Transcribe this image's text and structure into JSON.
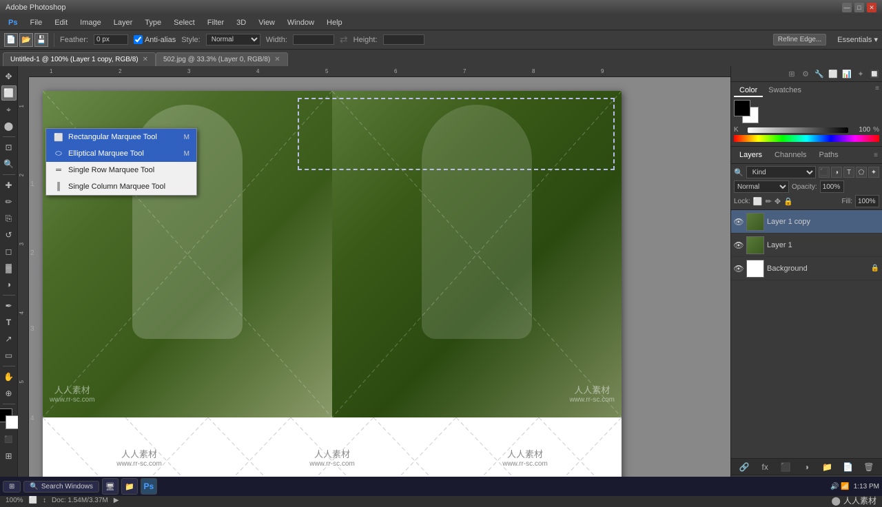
{
  "app": {
    "title": "Adobe Photoshop",
    "ps_icon": "Ps"
  },
  "title_bar": {
    "title": "Adobe Photoshop",
    "minimize": "—",
    "maximize": "□",
    "close": "✕"
  },
  "menu_bar": {
    "items": [
      "Ps",
      "File",
      "Edit",
      "Image",
      "Layer",
      "Type",
      "Select",
      "Filter",
      "3D",
      "View",
      "Window",
      "Help"
    ]
  },
  "options_bar": {
    "feather_label": "Feather:",
    "feather_value": "0 px",
    "anti_alias_label": "Anti-alias",
    "style_label": "Style:",
    "style_value": "Normal",
    "width_label": "Width:",
    "height_label": "Height:",
    "refine_edge": "Refine Edge..."
  },
  "tabs": [
    {
      "label": "Untitled-1 @ 100% (Layer 1 copy, RGB/8)",
      "active": true,
      "close": "✕"
    },
    {
      "label": "502.jpg @ 33.3% (Layer 0, RGB/8)",
      "active": false,
      "close": "✕"
    }
  ],
  "tools": [
    {
      "name": "move-tool",
      "icon": "✥"
    },
    {
      "name": "marquee-tool",
      "icon": "⬜",
      "active": true
    },
    {
      "name": "lasso-tool",
      "icon": "⌖"
    },
    {
      "name": "quick-select-tool",
      "icon": "⬤"
    },
    {
      "name": "crop-tool",
      "icon": "⊡"
    },
    {
      "name": "eyedropper-tool",
      "icon": "🔍"
    },
    {
      "name": "healing-tool",
      "icon": "✚"
    },
    {
      "name": "brush-tool",
      "icon": "✏"
    },
    {
      "name": "stamp-tool",
      "icon": "⎘"
    },
    {
      "name": "eraser-tool",
      "icon": "◻"
    },
    {
      "name": "gradient-tool",
      "icon": "▓"
    },
    {
      "name": "dodge-tool",
      "icon": "◑"
    },
    {
      "name": "pen-tool",
      "icon": "✒"
    },
    {
      "name": "text-tool",
      "icon": "T"
    },
    {
      "name": "shape-tool",
      "icon": "▭"
    },
    {
      "name": "hand-tool",
      "icon": "✋"
    },
    {
      "name": "zoom-tool",
      "icon": "🔍"
    }
  ],
  "context_menu": {
    "items": [
      {
        "label": "Rectangular Marquee Tool",
        "shortcut": "M",
        "icon": "⬜",
        "active": false
      },
      {
        "label": "Elliptical Marquee Tool",
        "shortcut": "M",
        "icon": "⬭",
        "active": true
      },
      {
        "label": "Single Row Marquee Tool",
        "shortcut": "",
        "icon": "═"
      },
      {
        "label": "Single Column Marquee Tool",
        "shortcut": "",
        "icon": "║"
      }
    ]
  },
  "canvas": {
    "zoom": "100%",
    "doc_size": "Doc: 1.54M/3.37M"
  },
  "ruler": {
    "ticks": [
      "1",
      "2",
      "3",
      "4",
      "5",
      "6",
      "7",
      "8",
      "9"
    ]
  },
  "color_panel": {
    "tabs": [
      "Color",
      "Swatches"
    ],
    "active_tab": "Color",
    "k_label": "K",
    "k_value": "100",
    "percent": "%"
  },
  "layers_panel": {
    "title": "Layers",
    "tabs": [
      "Layers",
      "Channels",
      "Paths"
    ],
    "active_tab": "Layers",
    "kind_label": "Kind",
    "blend_mode": "Normal",
    "opacity_label": "Opacity:",
    "opacity_value": "100%",
    "lock_label": "Lock:",
    "fill_label": "Fill:",
    "fill_value": "100%",
    "layers": [
      {
        "name": "Layer 1 copy",
        "visible": true,
        "active": true,
        "type": "image"
      },
      {
        "name": "Layer 1",
        "visible": true,
        "active": false,
        "type": "image"
      },
      {
        "name": "Background",
        "visible": true,
        "active": false,
        "type": "background",
        "locked": true
      }
    ]
  },
  "status_bar": {
    "zoom": "100%",
    "doc_info": "Doc: 1.54M/3.37M"
  },
  "taskbar": {
    "start": "Start",
    "search": "Search Windows",
    "time": "1:13 PM",
    "apps": [
      "🖥",
      "📁",
      "Ps"
    ]
  },
  "watermarks": [
    {
      "chinese": "人人素材",
      "url": "www.rr-sc.com"
    },
    {
      "chinese": "人人素材",
      "url": "www.rr-sc.com"
    },
    {
      "chinese": "人人素材",
      "url": "www.rr-sc.com"
    }
  ]
}
